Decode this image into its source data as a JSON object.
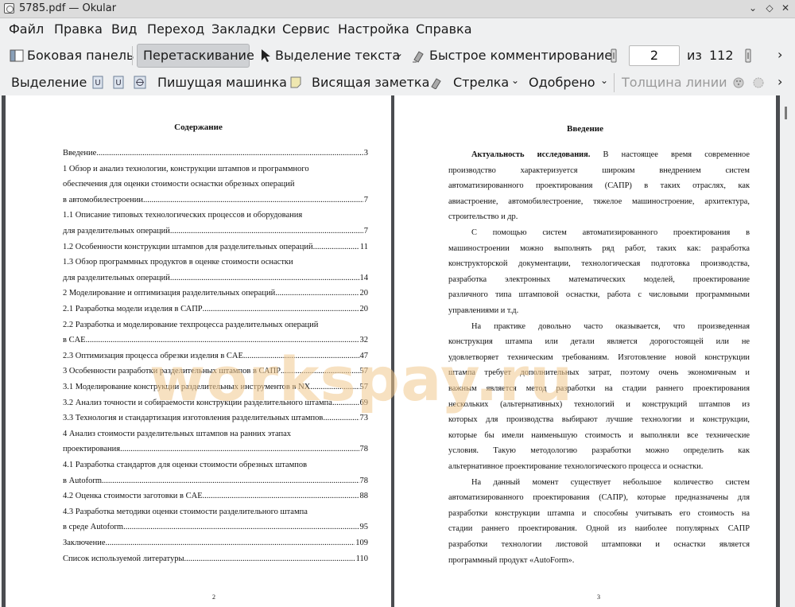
{
  "window": {
    "title": "5785.pdf — Okular"
  },
  "menu": [
    "Файл",
    "Правка",
    "Вид",
    "Переход",
    "Закладки",
    "Сервис",
    "Настройка",
    "Справка"
  ],
  "toolbar1": {
    "sidebar": "Боковая панель",
    "drag": "Перетаскивание",
    "text_select": "Выделение текста",
    "quick_comment": "Быстрое комментирование",
    "page_value": "2",
    "of_label": "из",
    "page_total": "112"
  },
  "toolbar2": {
    "selection": "Выделение",
    "typewriter": "Пишущая машинка",
    "sticky_note": "Висящая заметка",
    "arrow": "Стрелка",
    "approved": "Одобрено",
    "line_width": "Толщина линии"
  },
  "left_page": {
    "heading": "Содержание",
    "page_number": "2",
    "toc": [
      {
        "text": "Введение",
        "page": "3"
      },
      {
        "text": "1 Обзор и анализ технологии, конструкции штампов и программного",
        "page": ""
      },
      {
        "text": "обеспечения для оценки стоимости оснастки обрезных операций",
        "page": ""
      },
      {
        "text": "в автомобилестроении",
        "page": "7"
      },
      {
        "text": "1.1 Описание типовых технологических процессов и оборудования",
        "page": ""
      },
      {
        "text": "для разделительных операций",
        "page": "7"
      },
      {
        "text": "1.2 Особенности конструкции штампов для разделительных операций",
        "page": "11"
      },
      {
        "text": "1.3 Обзор программных продуктов в оценке стоимости оснастки",
        "page": ""
      },
      {
        "text": "для разделительных операций",
        "page": "14"
      },
      {
        "text": "2 Моделирование и оптимизация разделительных операций",
        "page": "20"
      },
      {
        "text": "2.1 Разработка модели изделия в САПР",
        "page": "20"
      },
      {
        "text": "2.2 Разработка и моделирование техпроцесса разделительных операций",
        "page": ""
      },
      {
        "text": "в CAE",
        "page": "32"
      },
      {
        "text": "2.3 Оптимизация процесса обрезки изделия в CAE",
        "page": "47"
      },
      {
        "text": "3 Особенности разработки разделительных штампов в САПР",
        "page": "57"
      },
      {
        "text": "3.1 Моделирование конструкции разделительных инструментов в NX",
        "page": "57"
      },
      {
        "text": "3.2 Анализ точности и собираемости конструкции разделительного штампа",
        "page": "69"
      },
      {
        "text": "3.3 Технология и стандартизация изготовления разделительных штампов",
        "page": "73"
      },
      {
        "text": "4 Анализ стоимости разделительных штампов на ранних этапах",
        "page": ""
      },
      {
        "text": "проектирования",
        "page": "78"
      },
      {
        "text": "4.1 Разработка стандартов для оценки стоимости обрезных штампов",
        "page": ""
      },
      {
        "text": "в Autoform",
        "page": "78"
      },
      {
        "text": "4.2 Оценка стоимости заготовки в CAE",
        "page": "88"
      },
      {
        "text": "4.3 Разработка методики оценки стоимости разделительного штампа",
        "page": ""
      },
      {
        "text": "в среде Autoform",
        "page": "95"
      },
      {
        "text": "Заключение",
        "page": "109"
      },
      {
        "text": "Список используемой литературы",
        "page": "110"
      }
    ]
  },
  "right_page": {
    "heading": "Введение",
    "page_number": "3",
    "lines": [
      {
        "t": "Актуальность исследования. В настоящее время современное",
        "bold_prefix": "Актуальность исследования.",
        "indent": true,
        "justify": true
      },
      {
        "t": "производство характеризуется широким внедрением систем",
        "justify": true
      },
      {
        "t": "автоматизированного проектирования (САПР) в таких отраслях, как",
        "justify": true
      },
      {
        "t": "авиастроение, автомобилестроение, тяжелое машиностроение, архитектура,",
        "justify": true
      },
      {
        "t": "строительство и др.",
        "justify": false
      },
      {
        "t": "С помощью систем автоматизированного проектирования в",
        "indent": true,
        "justify": true
      },
      {
        "t": "машиностроении можно выполнять ряд работ, таких как: разработка",
        "justify": true
      },
      {
        "t": "конструкторской документации, технологическая подготовка производства,",
        "justify": true
      },
      {
        "t": "разработка электронных математических моделей, проектирование",
        "justify": true
      },
      {
        "t": "различного типа штамповой оснастки, работа с числовыми программными",
        "justify": true
      },
      {
        "t": "управлениями и т.д.",
        "justify": false
      },
      {
        "t": "На практике довольно часто оказывается, что произведенная",
        "indent": true,
        "justify": true
      },
      {
        "t": "конструкция штампа или детали является дорогостоящей или не",
        "justify": true
      },
      {
        "t": "удовлетворяет техническим требованиям. Изготовление новой конструкции",
        "justify": true
      },
      {
        "t": "штампа требует дополнительных затрат, поэтому очень экономичным и",
        "justify": true
      },
      {
        "t": "важным является метод разработки на стадии раннего проектирования",
        "justify": true
      },
      {
        "t": "нескольких (альтернативных) технологий и конструкций штампов из",
        "justify": true
      },
      {
        "t": "которых для производства выбирают лучшие технологии и конструкции,",
        "justify": true
      },
      {
        "t": "которые бы имели наименьшую стоимость и выполняли все технические",
        "justify": true
      },
      {
        "t": "условия. Такую методологию разработки можно определить как",
        "justify": true
      },
      {
        "t": "альтернативное проектирование технологического процесса и оснастки.",
        "justify": false
      },
      {
        "t": "На данный момент существует небольшое количество систем",
        "indent": true,
        "justify": true
      },
      {
        "t": "автоматизированного проектирования (САПР), которые предназначены для",
        "justify": true
      },
      {
        "t": "разработки конструкции штампа и способны учитывать его стоимость на",
        "justify": true
      },
      {
        "t": "стадии раннего проектирования. Одной из наиболее популярных САПР",
        "justify": true
      },
      {
        "t": "разработки технологии листовой штамповки и оснастки является",
        "justify": true
      },
      {
        "t": "программный продукт «AutoForm».",
        "justify": false
      }
    ]
  },
  "watermark": "workspay.ru",
  "colors": {
    "window_bg": "#eff0f1",
    "doc_bg": "#4a4c50",
    "pressed_bg": "#cfd1d4",
    "watermark": "#f2c98f"
  }
}
